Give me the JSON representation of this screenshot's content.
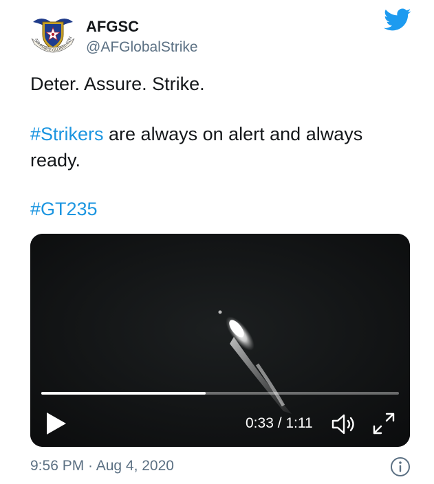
{
  "account": {
    "display_name": "AFGSC",
    "handle": "@AFGlobalStrike",
    "avatar_icon": "afgsc-emblem-icon",
    "avatar_seal_text": "AIR FORCE GLOBAL STRIKE COMMAND"
  },
  "brand": {
    "logo_icon": "twitter-bird-icon",
    "accent_color": "#1b95e0",
    "logo_color": "#1d9bf0"
  },
  "tweet": {
    "line1": "Deter. Assure. Strike.",
    "line2_hashtag": "#Strikers",
    "line2_rest": " are always on alert and always",
    "line3": "ready.",
    "line4_hashtag": "#GT235"
  },
  "video": {
    "progress": 0.46,
    "time_readout": "0:33 / 1:11",
    "play_icon": "play-icon",
    "volume_icon": "volume-icon",
    "fullscreen_icon": "fullscreen-expand-icon"
  },
  "footer": {
    "timestamp": "9:56 PM · Aug 4, 2020",
    "info_icon": "info-icon"
  }
}
